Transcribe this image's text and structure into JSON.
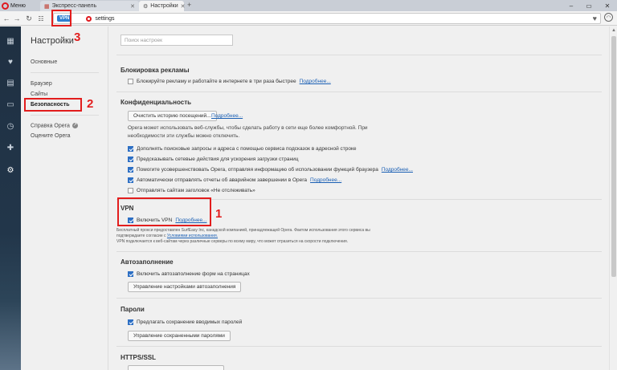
{
  "tabstrip": {
    "menu_label": "Меню",
    "tabs": [
      {
        "label": "Экспресс-панель"
      },
      {
        "label": "Настройки"
      }
    ]
  },
  "addressbar": {
    "vpn_badge": "VPN",
    "url": "settings"
  },
  "sidebar_nav": {
    "title": "Настройки",
    "items": [
      "Основные",
      "Браузер",
      "Сайты",
      "Безопасность",
      "Справка Opera",
      "Оцените Opera"
    ]
  },
  "content": {
    "search_placeholder": "Поиск настроек",
    "sections": {
      "adblock": {
        "title": "Блокировка рекламы",
        "option": "Блокируйте рекламу и работайте в интернете в три раза быстрее",
        "link": "Подробнее..."
      },
      "privacy": {
        "title": "Конфиденциальность",
        "clear_button": "Очистить историю посещений...",
        "link": "Подробнее...",
        "description": "Opera может использовать веб-службы, чтобы сделать работу в сети еще более комфортной. При необходимости эти службы можно отключить.",
        "options": [
          "Дополнять поисковые запросы и адреса с помощью сервиса подсказок в адресной строке",
          "Предсказывать сетевые действия для ускорения загрузки страниц",
          "Помогите усовершенствовать Opera, отправляя информацию об использовании функций браузера",
          "Автоматически отправлять отчеты об аварийном завершении в Opera",
          "Отправлять сайтам заголовок «Не отслеживать»"
        ],
        "option_links": [
          "Подробнее...",
          "Подробнее..."
        ]
      },
      "vpn": {
        "title": "VPN",
        "option": "Включить VPN",
        "link": "Подробнее...",
        "note1": "Бесплатный прокси предоставлен SurfEasy Inc, канадской компанией, принадлежащей Opera. Фактом использования этого сервиса вы",
        "note2_prefix": "подтверждаете согласие с",
        "note2_link": "Условиями использования.",
        "note3": "VPN подключается к веб-сайтам через различные серверы по всему миру, что может отразиться на скорости подключения."
      },
      "autofill": {
        "title": "Автозаполнение",
        "option": "Включить автозаполнение форм на страницах",
        "button": "Управление настройками автозаполнения"
      },
      "passwords": {
        "title": "Пароли",
        "option": "Предлагать сохранение вводимых паролей",
        "button": "Управление сохраненными паролями"
      },
      "https": {
        "title": "HTTPS/SSL"
      }
    }
  },
  "annotations": [
    "1",
    "2",
    "3"
  ],
  "colors": {
    "annotation": "#e21d1d",
    "link": "#1a5fb4",
    "checkbox": "#2d6fc4",
    "vpn_badge": "#2d7fd1",
    "opera_red": "#e0191e"
  }
}
